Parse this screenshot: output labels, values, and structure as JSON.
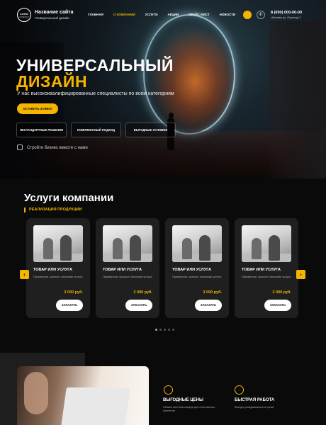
{
  "header": {
    "logo": "LOGO",
    "logo_sub": "COMPANY",
    "site_name": "Название сайта",
    "site_sub": "Универсальный дизайн",
    "nav": [
      "ГЛАВНАЯ",
      "О КОМПАНИИ",
      "УСЛУГИ",
      "АКЦИИ",
      "ПРАЙС-ЛИСТ",
      "НОВОСТИ"
    ],
    "active_nav": "О КОМПАНИИ",
    "phone": "8 (000) 000-00-00",
    "address": "г.Москва ул. Переход 2"
  },
  "hero": {
    "title_line1": "УНИВЕРСАЛЬНЫЙ",
    "title_line2": "ДИЗАЙН",
    "subtitle": "У нас высококвалифицированные  специалисты по всем категориям",
    "cta": "ОСТАВИТЬ ЗАЯВКУ",
    "features": [
      "НЕСТАНДАРТНЫЕ РЕШЕНИЯ",
      "КОМПЛЕКСНЫЙ ПОДХОД",
      "ВЫГОДНЫЕ УСЛОВИЯ"
    ],
    "tagline": "Стройте бизнес вместе с нами"
  },
  "services": {
    "title": "Услуги компании",
    "tab": "РЕАЛИЗАЦИЯ ПРОДУКЦИИ",
    "cards": [
      {
        "name": "ТОВАР ИЛИ УСЛУГА",
        "desc": "Примерное, краткое описание услуги",
        "price": "3 000 руб.",
        "button": "ЗАКАЗАТЬ"
      },
      {
        "name": "ТОВАР ИЛИ УСЛУГА",
        "desc": "Примерное, краткое описание услуги",
        "price": "3 000 руб.",
        "button": "ЗАКАЗАТЬ"
      },
      {
        "name": "ТОВАР ИЛИ УСЛУГА",
        "desc": "Примерное, краткое описание услуги",
        "price": "3 000 руб.",
        "button": "ЗАКАЗАТЬ"
      },
      {
        "name": "ТОВАР ИЛИ УСЛУГА",
        "desc": "Примерное, краткое описание услуги",
        "price": "3 000 руб.",
        "button": "ЗАКАЗАТЬ"
      }
    ],
    "prev_icon": "chevron-left-icon",
    "next_icon": "chevron-right-icon"
  },
  "advantages": [
    {
      "title": "ВЫГОДНЫЕ ЦЕНЫ",
      "desc": "Гибкая система скидок для постоянных клиентов"
    },
    {
      "title": "БЫСТРАЯ РАБОТА",
      "desc": "Всегда укладываемся в сроки"
    }
  ],
  "colors": {
    "accent": "#f4b400",
    "background": "#0a0a0a",
    "card": "#1f1f1f"
  }
}
